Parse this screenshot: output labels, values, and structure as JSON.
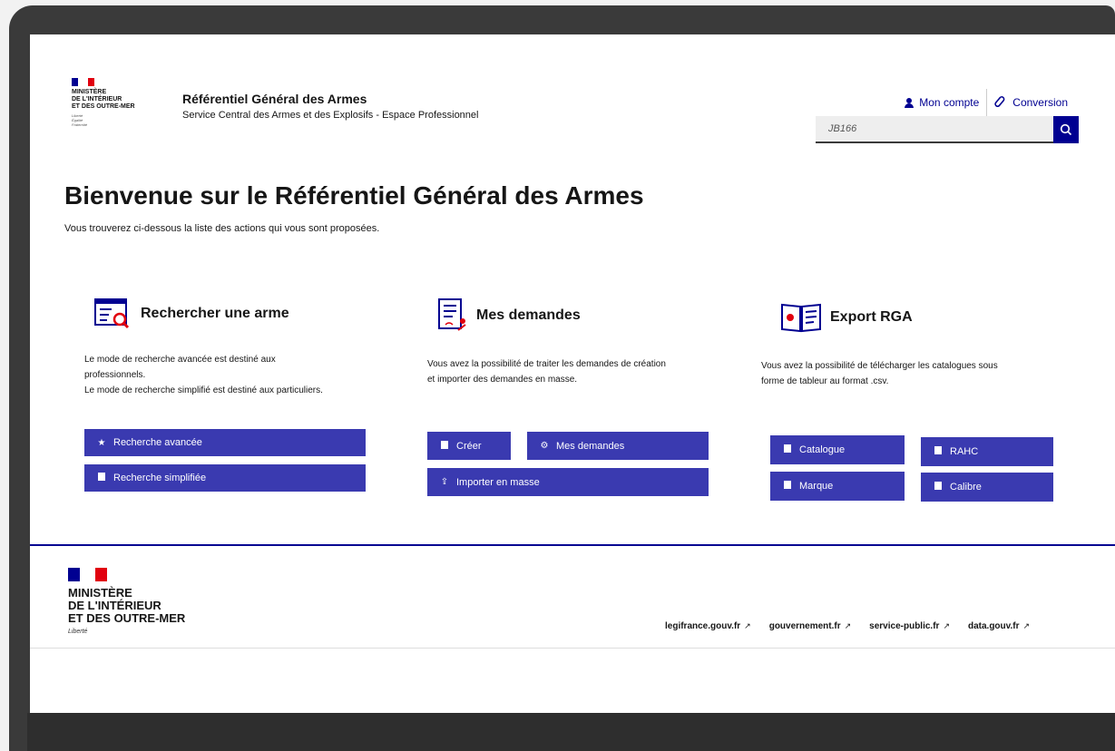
{
  "header": {
    "logo_lines": [
      "MINISTÈRE",
      "DE L'INTÉRIEUR",
      "ET DES OUTRE-MER"
    ],
    "motto_lines": [
      "Liberté",
      "Égalité",
      "Fraternité"
    ],
    "title": "Référentiel Général des Armes",
    "subtitle": "Service Central des Armes et des Explosifs - Espace Professionnel",
    "account_label": "Mon compte",
    "conversion_label": "Conversion",
    "search_value": "JB166"
  },
  "welcome": {
    "title": "Bienvenue sur le Référentiel Général des Armes",
    "subtitle": "Vous trouverez ci-dessous la liste des actions qui vous sont proposées."
  },
  "sections": {
    "search": {
      "title": "Rechercher une arme",
      "desc_line1": "Le mode de recherche avancée est destiné aux",
      "desc_line2": "professionnels.",
      "desc_line3": "Le mode de recherche simplifié est destiné aux particuliers.",
      "btn_advanced": "Recherche avancée",
      "btn_simple": "Recherche simplifiée"
    },
    "requests": {
      "title": "Mes demandes",
      "desc_line1": "Vous avez la possibilité de traiter les demandes de création",
      "desc_line2": "et importer des demandes en masse.",
      "btn_create": "Créer",
      "btn_my_requests": "Mes demandes",
      "btn_import": "Importer en masse"
    },
    "export": {
      "title": "Export RGA",
      "desc_line1": "Vous avez la possibilité de télécharger les catalogues sous",
      "desc_line2": "forme de tableur au format .csv.",
      "btn_catalogue": "Catalogue",
      "btn_rahc": "RAHC",
      "btn_marque": "Marque",
      "btn_calibre": "Calibre"
    }
  },
  "footer": {
    "logo_lines": [
      "MINISTÈRE",
      "DE L'INTÉRIEUR",
      "ET DES OUTRE-MER"
    ],
    "motto": "Liberté",
    "links": [
      "legifrance.gouv.fr",
      "gouvernement.fr",
      "service-public.fr",
      "data.gouv.fr"
    ]
  },
  "colors": {
    "primary": "#000091",
    "button": "#3a3ab0",
    "marianne_red": "#e1000f"
  }
}
